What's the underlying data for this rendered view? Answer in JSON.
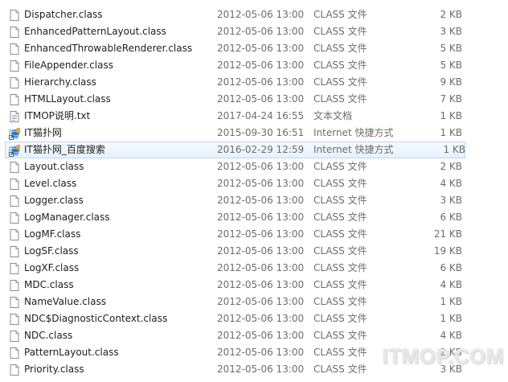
{
  "files": [
    {
      "name": "Dispatcher.class",
      "date": "2012-05-06 13:00",
      "type": "CLASS 文件",
      "size": "2 KB",
      "icon": "class-file-icon"
    },
    {
      "name": "EnhancedPatternLayout.class",
      "date": "2012-05-06 13:00",
      "type": "CLASS 文件",
      "size": "3 KB",
      "icon": "class-file-icon"
    },
    {
      "name": "EnhancedThrowableRenderer.class",
      "date": "2012-05-06 13:00",
      "type": "CLASS 文件",
      "size": "5 KB",
      "icon": "class-file-icon"
    },
    {
      "name": "FileAppender.class",
      "date": "2012-05-06 13:00",
      "type": "CLASS 文件",
      "size": "5 KB",
      "icon": "class-file-icon"
    },
    {
      "name": "Hierarchy.class",
      "date": "2012-05-06 13:00",
      "type": "CLASS 文件",
      "size": "9 KB",
      "icon": "class-file-icon"
    },
    {
      "name": "HTMLLayout.class",
      "date": "2012-05-06 13:00",
      "type": "CLASS 文件",
      "size": "7 KB",
      "icon": "class-file-icon"
    },
    {
      "name": "ITMOP说明.txt",
      "date": "2017-04-24 16:55",
      "type": "文本文档",
      "size": "1 KB",
      "icon": "text-file-icon"
    },
    {
      "name": "IT猫扑网",
      "date": "2015-09-30 16:51",
      "type": "Internet 快捷方式",
      "size": "1 KB",
      "icon": "internet-shortcut-icon"
    },
    {
      "name": "IT猫扑网_百度搜索",
      "date": "2016-02-29 12:59",
      "type": "Internet 快捷方式",
      "size": "1 KB",
      "icon": "internet-shortcut-icon",
      "selected": true
    },
    {
      "name": "Layout.class",
      "date": "2012-05-06 13:00",
      "type": "CLASS 文件",
      "size": "2 KB",
      "icon": "class-file-icon"
    },
    {
      "name": "Level.class",
      "date": "2012-05-06 13:00",
      "type": "CLASS 文件",
      "size": "4 KB",
      "icon": "class-file-icon"
    },
    {
      "name": "Logger.class",
      "date": "2012-05-06 13:00",
      "type": "CLASS 文件",
      "size": "3 KB",
      "icon": "class-file-icon"
    },
    {
      "name": "LogManager.class",
      "date": "2012-05-06 13:00",
      "type": "CLASS 文件",
      "size": "6 KB",
      "icon": "class-file-icon"
    },
    {
      "name": "LogMF.class",
      "date": "2012-05-06 13:00",
      "type": "CLASS 文件",
      "size": "21 KB",
      "icon": "class-file-icon"
    },
    {
      "name": "LogSF.class",
      "date": "2012-05-06 13:00",
      "type": "CLASS 文件",
      "size": "19 KB",
      "icon": "class-file-icon"
    },
    {
      "name": "LogXF.class",
      "date": "2012-05-06 13:00",
      "type": "CLASS 文件",
      "size": "6 KB",
      "icon": "class-file-icon"
    },
    {
      "name": "MDC.class",
      "date": "2012-05-06 13:00",
      "type": "CLASS 文件",
      "size": "4 KB",
      "icon": "class-file-icon"
    },
    {
      "name": "NameValue.class",
      "date": "2012-05-06 13:00",
      "type": "CLASS 文件",
      "size": "1 KB",
      "icon": "class-file-icon"
    },
    {
      "name": "NDC$DiagnosticContext.class",
      "date": "2012-05-06 13:00",
      "type": "CLASS 文件",
      "size": "1 KB",
      "icon": "class-file-icon"
    },
    {
      "name": "NDC.class",
      "date": "2012-05-06 13:00",
      "type": "CLASS 文件",
      "size": "4 KB",
      "icon": "class-file-icon"
    },
    {
      "name": "PatternLayout.class",
      "date": "2012-05-06 13:00",
      "type": "CLASS 文件",
      "size": "2 KB",
      "icon": "class-file-icon"
    },
    {
      "name": "Priority.class",
      "date": "2012-05-06 13:00",
      "type": "CLASS 文件",
      "size": "3 KB",
      "icon": "class-file-icon"
    }
  ],
  "watermark": "ITMOP.COM",
  "colors": {
    "name_text": "#1e1e1e",
    "meta_text": "#6d6d6d",
    "selection_border": "#bcd8f4",
    "selection_fill": "#e6f1fc"
  }
}
